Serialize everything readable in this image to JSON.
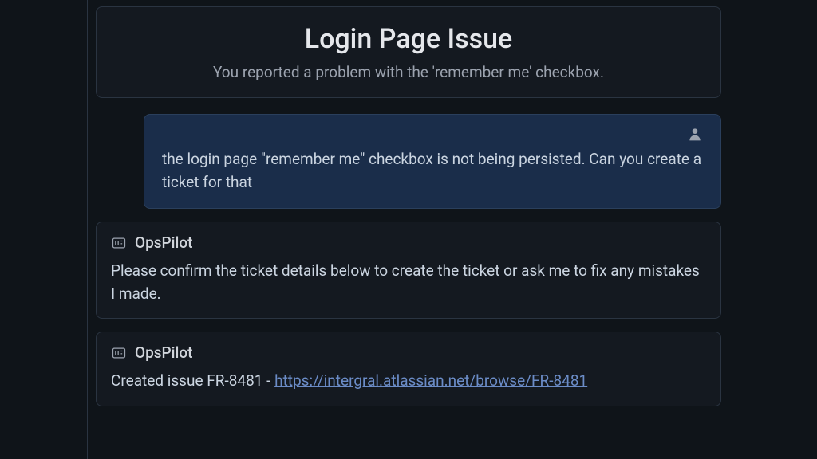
{
  "header": {
    "title": "Login Page Issue",
    "subtitle": "You reported a problem with the 'remember me' checkbox."
  },
  "messages": {
    "user": {
      "text": "the login page \"remember me\" checkbox is not being persisted. Can you create a ticket for that"
    },
    "bot1": {
      "name": "OpsPilot",
      "text": "Please confirm the ticket details below to create the ticket or ask me to fix any mistakes I made."
    },
    "bot2": {
      "name": "OpsPilot",
      "text_prefix": "Created issue FR-8481 - ",
      "link_text": "https://intergral.atlassian.net/browse/FR-8481",
      "link_href": "https://intergral.atlassian.net/browse/FR-8481"
    }
  }
}
